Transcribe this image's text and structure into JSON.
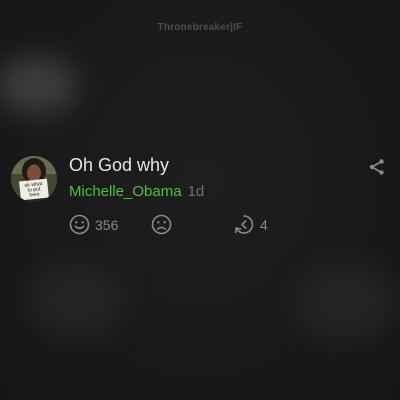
{
  "watermark": "Thronebreaker|IF",
  "post": {
    "title": "Oh God why",
    "author": "Michelle_Obama",
    "age": "1d",
    "avatar_sign": {
      "lines": [
        "ok what",
        "to put",
        "here"
      ]
    },
    "stats": {
      "likes": "356",
      "replies": "4"
    }
  },
  "colors": {
    "background": "#1a1a1a",
    "author": "#47c23e",
    "title": "#e6e6e6",
    "meta": "#8a8a8a"
  },
  "icons": [
    "share-icon",
    "smile-icon",
    "frown-icon",
    "reply-icon"
  ]
}
